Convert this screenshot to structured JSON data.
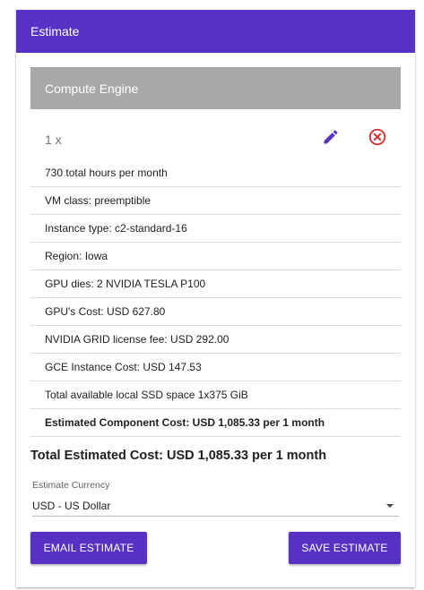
{
  "header": {
    "title": "Estimate"
  },
  "section": {
    "title": "Compute Engine"
  },
  "item": {
    "quantity": "1 x"
  },
  "details": [
    "730 total hours per month",
    "VM class: preemptible",
    "Instance type: c2-standard-16",
    "Region: Iowa",
    "GPU dies: 2 NVIDIA TESLA P100",
    "GPU's Cost: USD 627.80",
    "NVIDIA GRID license fee: USD 292.00",
    "GCE Instance Cost: USD 147.53",
    "Total available local SSD space 1x375 GiB",
    "Estimated Component Cost: USD 1,085.33 per 1 month"
  ],
  "total": "Total Estimated Cost: USD 1,085.33 per 1 month",
  "currency": {
    "label": "Estimate Currency",
    "value": "USD - US Dollar"
  },
  "actions": {
    "email_label": "EMAIL ESTIMATE",
    "save_label": "SAVE ESTIMATE"
  },
  "colors": {
    "accent": "#5631c3",
    "section_bg": "#a8a8a8",
    "remove": "#d32f2f"
  },
  "icons": {
    "edit": "pencil-icon",
    "remove": "close-circle-icon",
    "dropdown": "caret-down-icon"
  }
}
